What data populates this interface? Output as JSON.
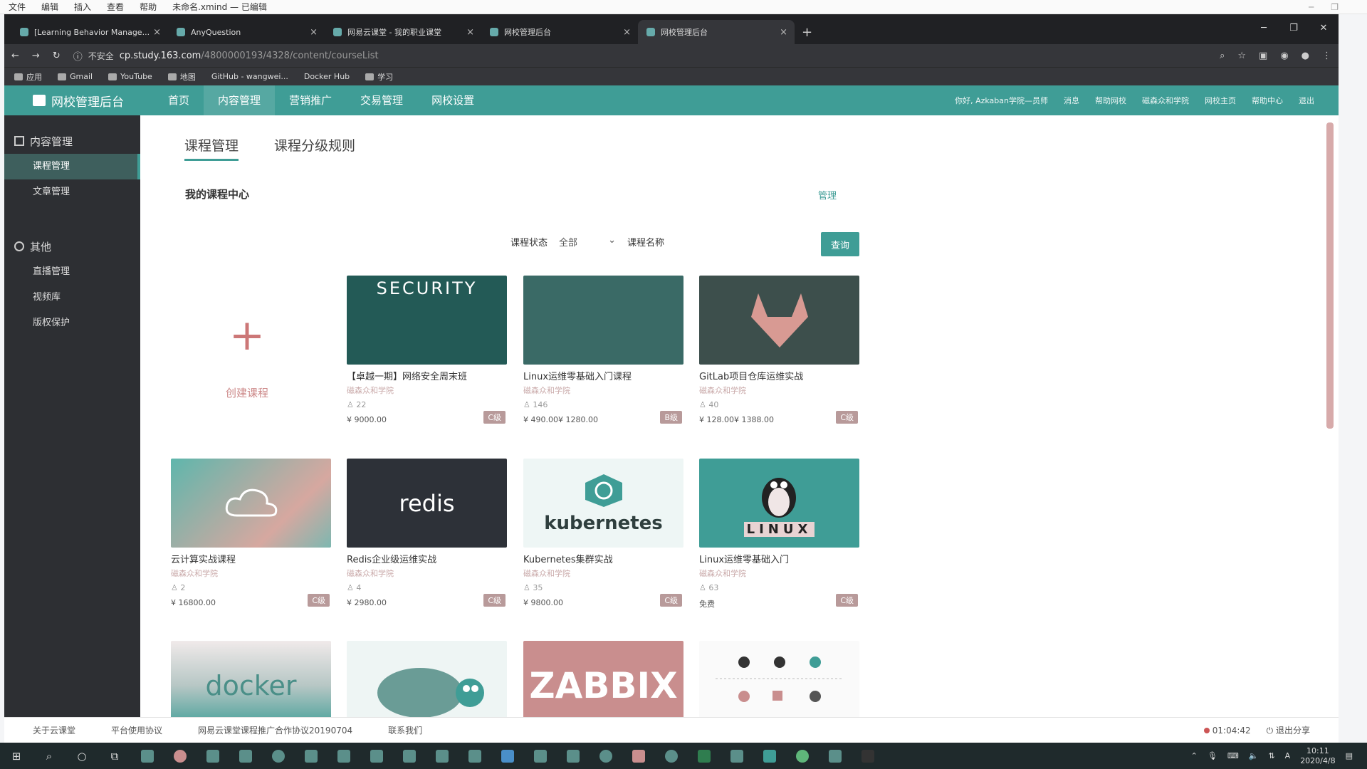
{
  "appmenu": {
    "items": [
      "文件",
      "编辑",
      "插入",
      "查看",
      "帮助"
    ],
    "doc_title": "未命名.xmind — 已编辑"
  },
  "browser": {
    "tabs": [
      {
        "label": "[Learning Behavior Manage..."
      },
      {
        "label": "AnyQuestion"
      },
      {
        "label": "网易云课堂 - 我的职业课堂"
      },
      {
        "label": "网校管理后台"
      },
      {
        "label": "网校管理后台"
      }
    ],
    "new_tab": "+",
    "insecure_label": "不安全",
    "url_host": "cp.study.163.com",
    "url_path": "/4800000193/4328/content/courseList",
    "bookmarks": [
      "应用",
      "Gmail",
      "YouTube",
      "地图",
      "GitHub - wangwei...",
      "Docker Hub",
      "学习"
    ]
  },
  "site": {
    "brand": "网校管理后台",
    "nav": [
      "首页",
      "内容管理",
      "营销推广",
      "交易管理",
      "网校设置"
    ],
    "nav_active": 1,
    "top_links": [
      "你好, Azkaban学院—员师",
      "消息",
      "帮助网校",
      "磁森众和学院",
      "网校主页",
      "帮助中心",
      "退出"
    ]
  },
  "sidebar": {
    "section1": "内容管理",
    "items1": [
      "课程管理",
      "文章管理"
    ],
    "section2": "其他",
    "items2": [
      "直播管理",
      "视频库",
      "版权保护"
    ]
  },
  "main": {
    "subtabs": [
      "课程管理",
      "课程分级规则"
    ],
    "center_title": "我的课程中心",
    "manage": "管理",
    "filter_status_label": "课程状态",
    "filter_status_value": "全部",
    "filter_name_label": "课程名称",
    "query_button": "查询",
    "create_label": "创建课程",
    "create_plus": "+"
  },
  "courses": [
    {
      "title": "【卓越一期】网络安全周末班",
      "org": "磁森众和学院",
      "students": "22",
      "price": "¥ 9000.00",
      "level": "C级",
      "thumb_text": "SECURITY"
    },
    {
      "title": "Linux运维零基础入门课程",
      "org": "磁森众和学院",
      "students": "146",
      "price": "¥ 490.00¥ 1280.00",
      "level": "B级",
      "thumb_text": ""
    },
    {
      "title": "GitLab项目仓库运维实战",
      "org": "磁森众和学院",
      "students": "40",
      "price": "¥ 128.00¥ 1388.00",
      "level": "C级",
      "thumb_text": ""
    },
    {
      "title": "云计算实战课程",
      "org": "磁森众和学院",
      "students": "2",
      "price": "¥ 16800.00",
      "level": "C级",
      "thumb_text": ""
    },
    {
      "title": "Redis企业级运维实战",
      "org": "磁森众和学院",
      "students": "4",
      "price": "¥ 2980.00",
      "level": "C级",
      "thumb_text": "redis"
    },
    {
      "title": "Kubernetes集群实战",
      "org": "磁森众和学院",
      "students": "35",
      "price": "¥ 9800.00",
      "level": "C级",
      "thumb_text": "kubernetes"
    },
    {
      "title": "Linux运维零基础入门",
      "org": "磁森众和学院",
      "students": "63",
      "price": "免费",
      "level": "C级",
      "thumb_text": "LINUX"
    },
    {
      "title": "",
      "org": "",
      "students": "",
      "price": "",
      "level": "",
      "thumb_text": "docker"
    },
    {
      "title": "",
      "org": "",
      "students": "",
      "price": "",
      "level": "",
      "thumb_text": ""
    },
    {
      "title": "",
      "org": "",
      "students": "",
      "price": "",
      "level": "",
      "thumb_text": "ZABBIX"
    },
    {
      "title": "",
      "org": "",
      "students": "",
      "price": "",
      "level": "",
      "thumb_text": ""
    }
  ],
  "footer": {
    "links": [
      "关于云课堂",
      "平台使用协议",
      "网易云课堂课程推广合作协议20190704",
      "联系我们"
    ],
    "record_time": "01:04:42",
    "exit_share": "退出分享"
  },
  "taskbar": {
    "time": "10:11",
    "date": "2020/4/8"
  }
}
